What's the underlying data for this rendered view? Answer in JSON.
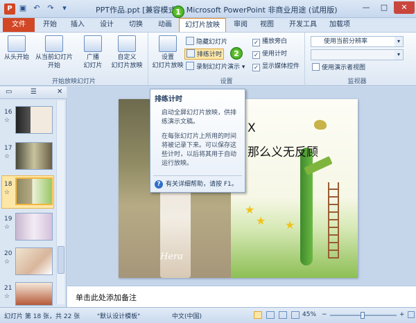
{
  "titlebar": {
    "app_letter": "P",
    "title": "PPT作品.ppt [兼容模式] - Microsoft PowerPoint 非商业用途 (试用版)",
    "qat": [
      "save-icon",
      "undo-icon",
      "redo-icon",
      "dropdown-icon"
    ],
    "min": "—",
    "max": "□",
    "close": "✕"
  },
  "tabs": {
    "file": "文件",
    "items": [
      "开始",
      "插入",
      "设计",
      "切换",
      "动画",
      "幻灯片放映",
      "审阅",
      "视图",
      "开发工具",
      "加载项"
    ],
    "active": "幻灯片放映"
  },
  "ribbon": {
    "group_start": {
      "label": "开始放映幻灯片",
      "from_start": "从头开始",
      "from_current_1": "从当前幻灯片",
      "from_current_2": "开始",
      "broadcast_1": "广播",
      "broadcast_2": "幻灯片",
      "custom_1": "自定义",
      "custom_2": "幻灯片放映"
    },
    "group_setup": {
      "label": "设置",
      "setup_1": "设置",
      "setup_2": "幻灯片放映",
      "hide_slide": "隐藏幻灯片",
      "rehearse": "排练计时",
      "record": "录制幻灯片演示",
      "record_arrow": "▾",
      "play_narration": "播放旁白",
      "use_timings": "使用计时",
      "show_media": "显示媒体控件",
      "check_mark": "✓"
    },
    "group_monitor": {
      "label": "监视器",
      "resolution": "使用当前分辨率",
      "monitor_empty": "",
      "presenter_view": "使用演示者视图",
      "dd_arrow": "▾"
    }
  },
  "badges": {
    "one": "1",
    "two": "2"
  },
  "slides_panel": {
    "tab_slides": "▭",
    "tab_outline": "☰",
    "close": "✕",
    "slides": [
      {
        "num": "16",
        "star": "☆"
      },
      {
        "num": "17",
        "star": "☆"
      },
      {
        "num": "18",
        "star": "☆",
        "selected": true
      },
      {
        "num": "19",
        "star": "☆"
      },
      {
        "num": "20",
        "star": "☆"
      },
      {
        "num": "21",
        "star": "☆"
      }
    ]
  },
  "slide": {
    "text_line1": "X",
    "text_line2": "那么义无反顾",
    "signature": "Hera"
  },
  "tooltip": {
    "title": "排练计时",
    "para1": "启动全屏幻灯片放映，供排练演示文稿。",
    "para2": "在每张幻灯片上所用的时间将被记录下来。可以保存这些计时，以后将其用于自动运行放映。",
    "help_icon": "?",
    "help": "有关详细帮助，请按 F1。"
  },
  "notes": {
    "placeholder": "单击此处添加备注"
  },
  "statusbar": {
    "slide_info": "幻灯片 第 18 张，共 22 张",
    "theme": "\"默认设计模板\"",
    "language": "中文(中国)",
    "zoom": "45%",
    "minus": "−",
    "plus": "+"
  }
}
